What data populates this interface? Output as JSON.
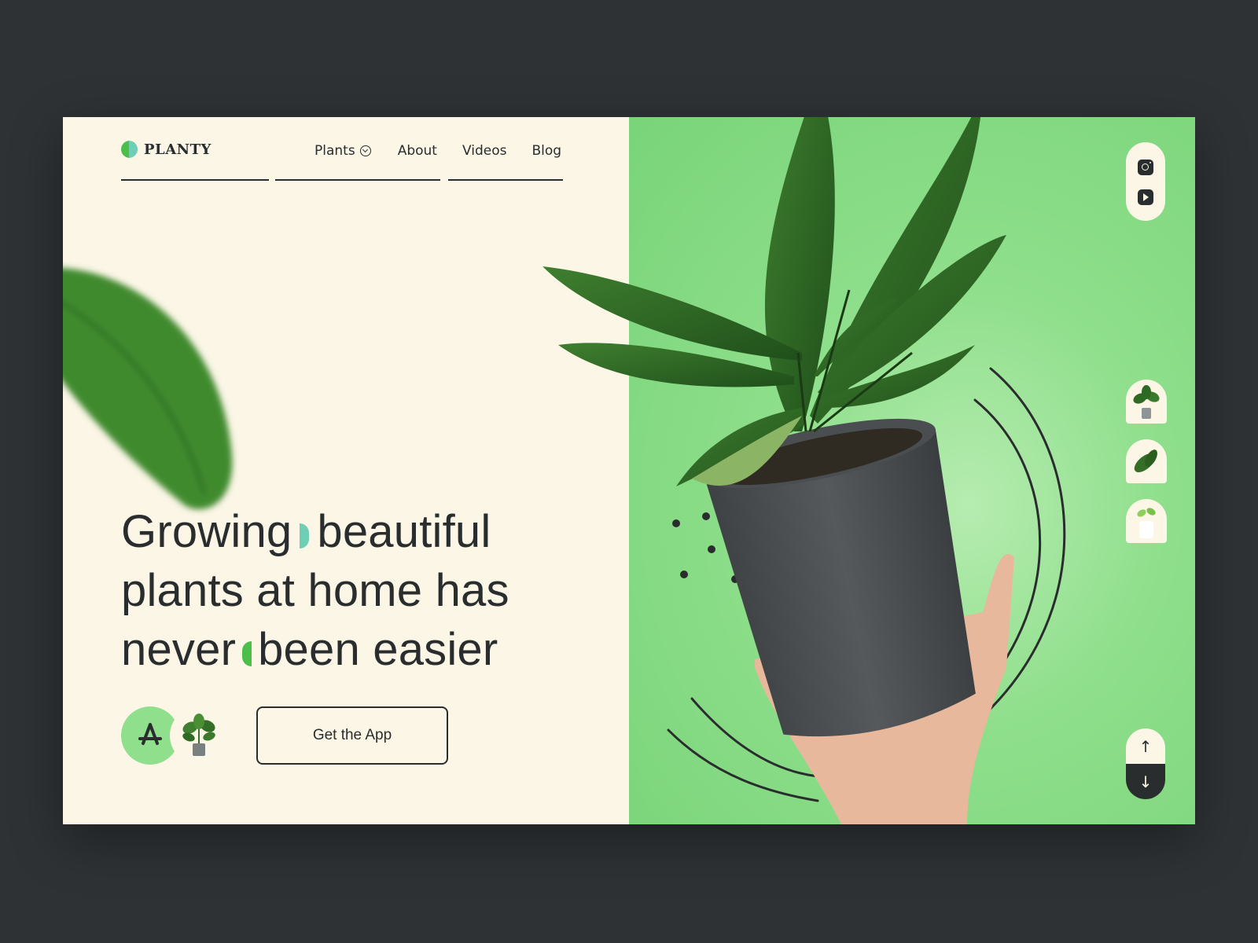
{
  "brand": {
    "name": "PLANTY"
  },
  "nav": {
    "items": [
      {
        "label": "Plants",
        "has_dropdown": true
      },
      {
        "label": "About"
      },
      {
        "label": "Videos"
      },
      {
        "label": "Blog"
      }
    ]
  },
  "hero": {
    "line1_a": "Growing",
    "line1_b": "beautiful",
    "line2": "plants at home has",
    "line3_a": "never",
    "line3_b": "been easier"
  },
  "cta": {
    "get_app_label": "Get the App",
    "store_icon": "app-store-icon",
    "plant_icon": "potted-plant-icon"
  },
  "social": {
    "icons": [
      "instagram-icon",
      "youtube-icon"
    ]
  },
  "thumbnails": [
    {
      "icon": "potted-plant-thumbnail"
    },
    {
      "icon": "leaf-plant-thumbnail"
    },
    {
      "icon": "white-pot-plant-thumbnail"
    }
  ],
  "scroll": {
    "up": "↑",
    "down": "↓"
  },
  "colors": {
    "page_bg": "#2e3234",
    "cream": "#fbf6e6",
    "green": "#8fdf8c",
    "accent_green": "#4cbf4a",
    "accent_teal": "#6fcfb6",
    "dark": "#2a2d2e"
  }
}
